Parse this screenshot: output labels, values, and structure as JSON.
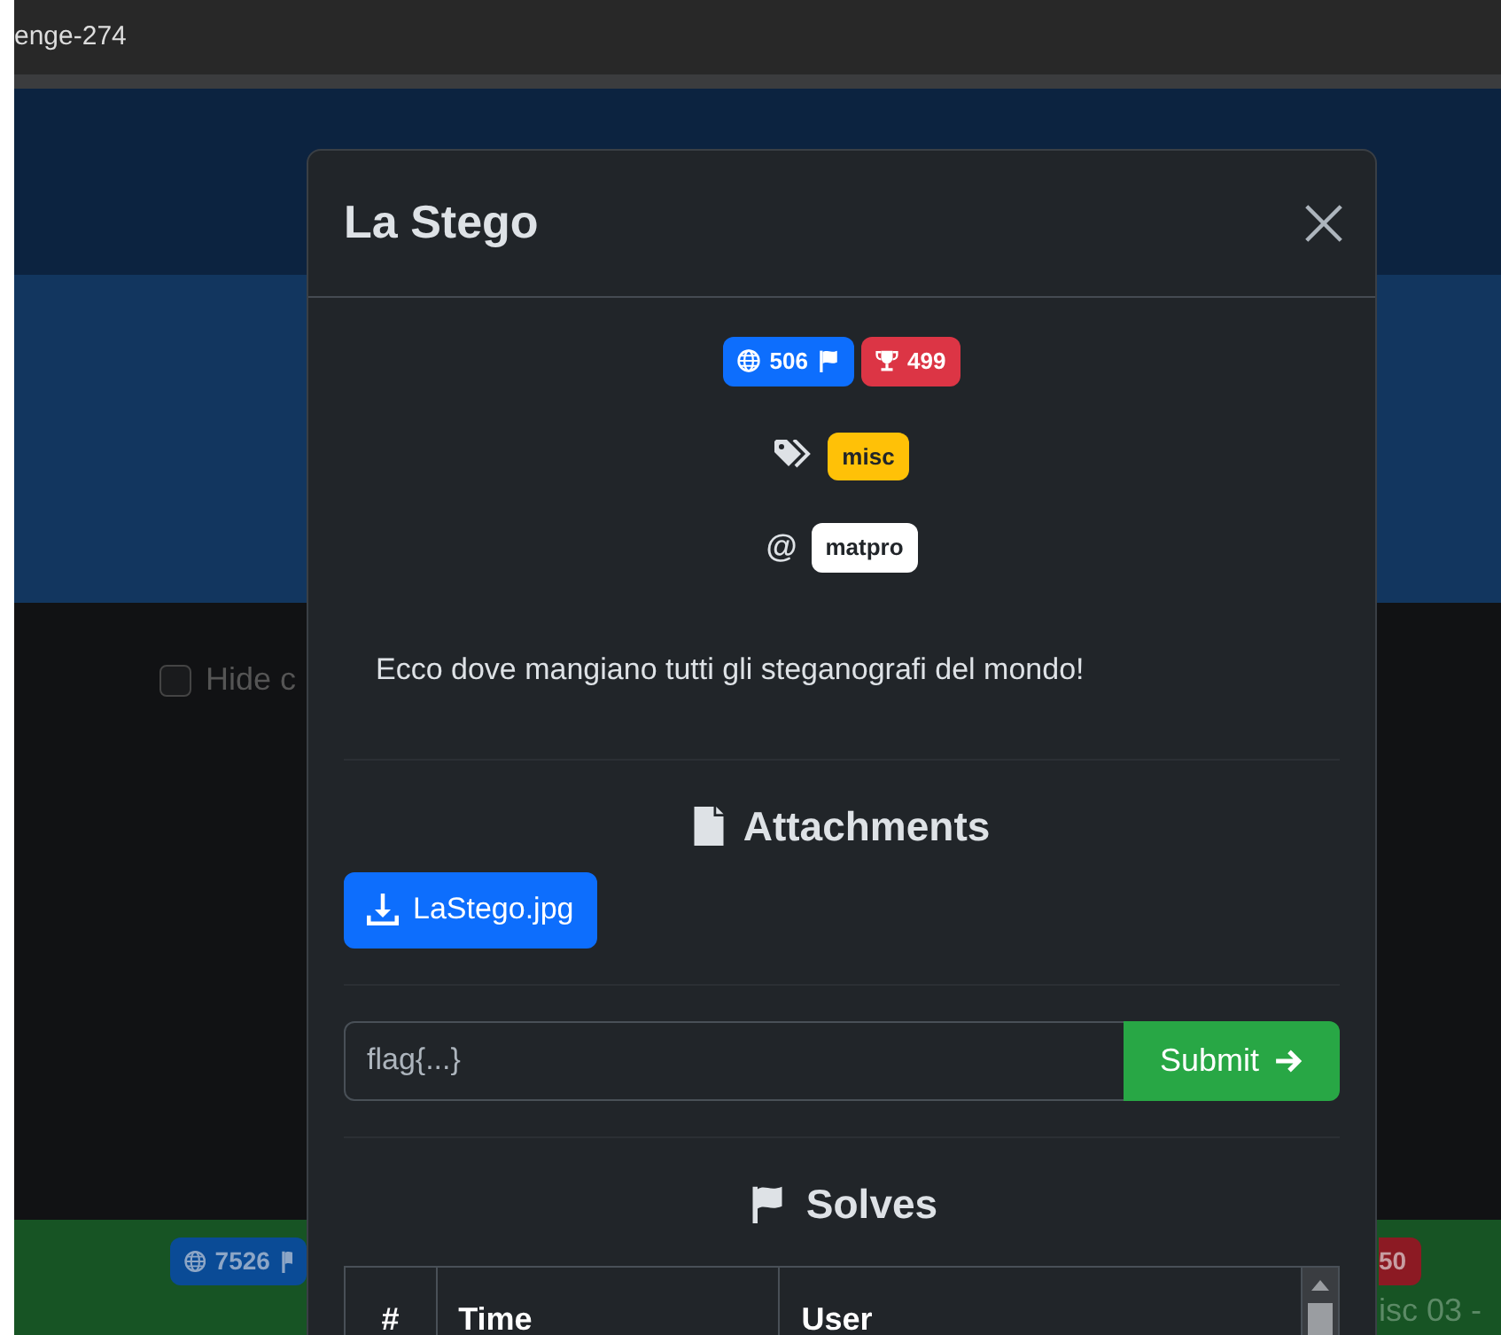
{
  "tab_title": "enge-274",
  "background": {
    "checkbox": {
      "label": "Hide c",
      "checked": false
    },
    "card": {
      "solves_badge": "7526",
      "points_badge": "50",
      "title": "isc 03 -"
    }
  },
  "modal": {
    "title": "La Stego",
    "solves_badge": "506",
    "points_badge": "499",
    "tags": [
      {
        "label": "misc"
      }
    ],
    "author_symbol": "@",
    "author": "matpro",
    "description": "Ecco dove mangiano tutti gli steganografi del mondo!",
    "attachments_heading": "Attachments",
    "attachments": [
      {
        "label": "LaStego.jpg"
      }
    ],
    "flag_input": {
      "placeholder": "flag{...}"
    },
    "submit": "Submit",
    "solves_heading": "Solves",
    "table": {
      "columns": [
        "#",
        "Time",
        "User"
      ]
    }
  }
}
